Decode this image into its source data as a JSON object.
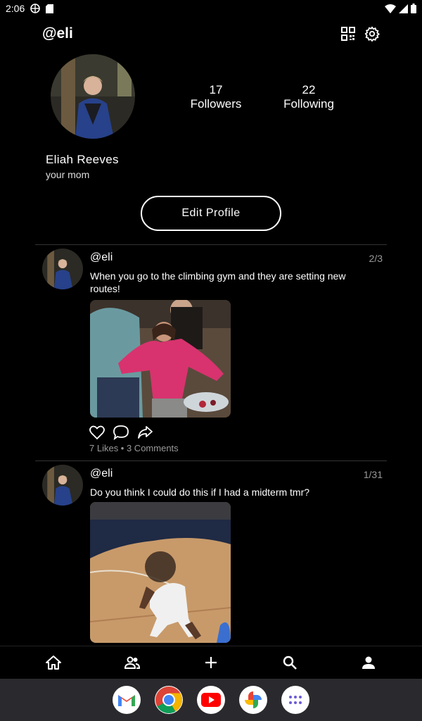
{
  "status_bar": {
    "time": "2:06"
  },
  "header": {
    "handle": "@eli"
  },
  "profile": {
    "followers_count": "17",
    "followers_label": "Followers",
    "following_count": "22",
    "following_label": "Following",
    "name": "Eliah Reeves",
    "bio": "your mom",
    "edit_button": "Edit Profile"
  },
  "posts": [
    {
      "handle": "@eli",
      "date": "2/3",
      "text": "When you go to the climbing gym and they are setting new routes!",
      "meta": "7 Likes • 3 Comments"
    },
    {
      "handle": "@eli",
      "date": "1/31",
      "text": "Do you think I could do this if I had a midterm tmr?"
    }
  ],
  "bottom_nav": [
    "home-icon",
    "people-icon",
    "add-icon",
    "search-icon",
    "profile-icon"
  ],
  "dock": [
    "gmail-icon",
    "chrome-icon",
    "youtube-icon",
    "photos-icon",
    "app-drawer-icon"
  ],
  "colors": {
    "background": "#000000",
    "text": "#ffffff",
    "muted": "#999999",
    "divider": "#333333"
  }
}
